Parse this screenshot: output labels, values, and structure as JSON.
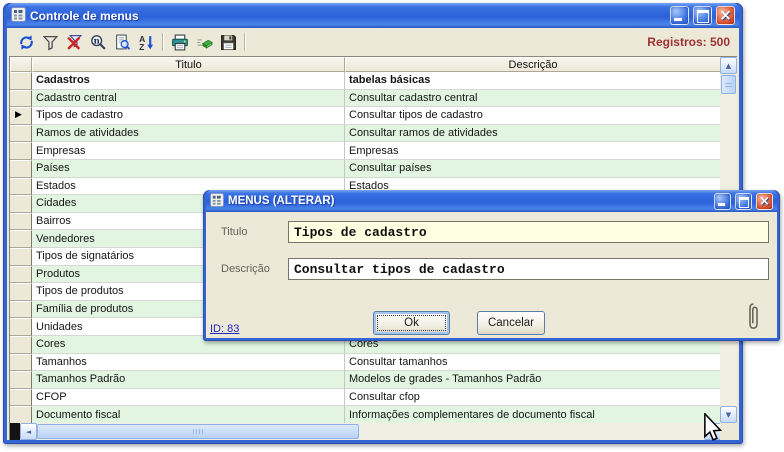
{
  "main_window": {
    "title": "Controle de menus",
    "records_label": "Registros: 500",
    "toolbar_icons": [
      "refresh",
      "filter",
      "clear-filter",
      "find",
      "preview",
      "sort-az",
      "print",
      "export",
      "save"
    ]
  },
  "table": {
    "columns": [
      "Titulo",
      "Descrição"
    ],
    "selected_row": 2,
    "rows": [
      {
        "titulo": "Cadastros",
        "descricao": "tabelas básicas",
        "bold": true
      },
      {
        "titulo": "Cadastro central",
        "descricao": "Consultar cadastro central"
      },
      {
        "titulo": "Tipos de cadastro",
        "descricao": "Consultar tipos de cadastro"
      },
      {
        "titulo": "Ramos de atividades",
        "descricao": "Consultar ramos de atividades"
      },
      {
        "titulo": "Empresas",
        "descricao": "Empresas"
      },
      {
        "titulo": "Países",
        "descricao": "Consultar países"
      },
      {
        "titulo": "Estados",
        "descricao": "Estados"
      },
      {
        "titulo": "Cidades",
        "descricao": ""
      },
      {
        "titulo": "Bairros",
        "descricao": ""
      },
      {
        "titulo": "Vendedores",
        "descricao": ""
      },
      {
        "titulo": "Tipos de signatários",
        "descricao": ""
      },
      {
        "titulo": "Produtos",
        "descricao": ""
      },
      {
        "titulo": "Tipos de produtos",
        "descricao": ""
      },
      {
        "titulo": "Família de produtos",
        "descricao": ""
      },
      {
        "titulo": "Unidades",
        "descricao": ""
      },
      {
        "titulo": "Cores",
        "descricao": "Cores"
      },
      {
        "titulo": "Tamanhos",
        "descricao": "Consultar tamanhos"
      },
      {
        "titulo": "Tamanhos Padrão",
        "descricao": "Modelos de grades - Tamanhos Padrão"
      },
      {
        "titulo": "CFOP",
        "descricao": "Consultar cfop"
      },
      {
        "titulo": "Documento fiscal",
        "descricao": "Informações complementares de documento fiscal"
      }
    ]
  },
  "dialog": {
    "title": "MENUS (ALTERAR)",
    "fields": [
      {
        "label": "Titulo",
        "value": "Tipos de cadastro"
      },
      {
        "label": "Descrição",
        "value": "Consultar tipos de cadastro"
      }
    ],
    "buttons": {
      "ok": "Ok",
      "cancel": "Cancelar"
    },
    "id_link": "ID: 83"
  },
  "colors": {
    "window_border_blue": "#3465d2",
    "titlebar_blue": "#2c60d8",
    "body_beige": "#ECE9D8",
    "row_green": "#E1F5E1",
    "records_maroon": "#9C3234",
    "input_yellow": "#FFFFE1",
    "link_blue": "#2626BE",
    "close_red": "#e05a34"
  }
}
